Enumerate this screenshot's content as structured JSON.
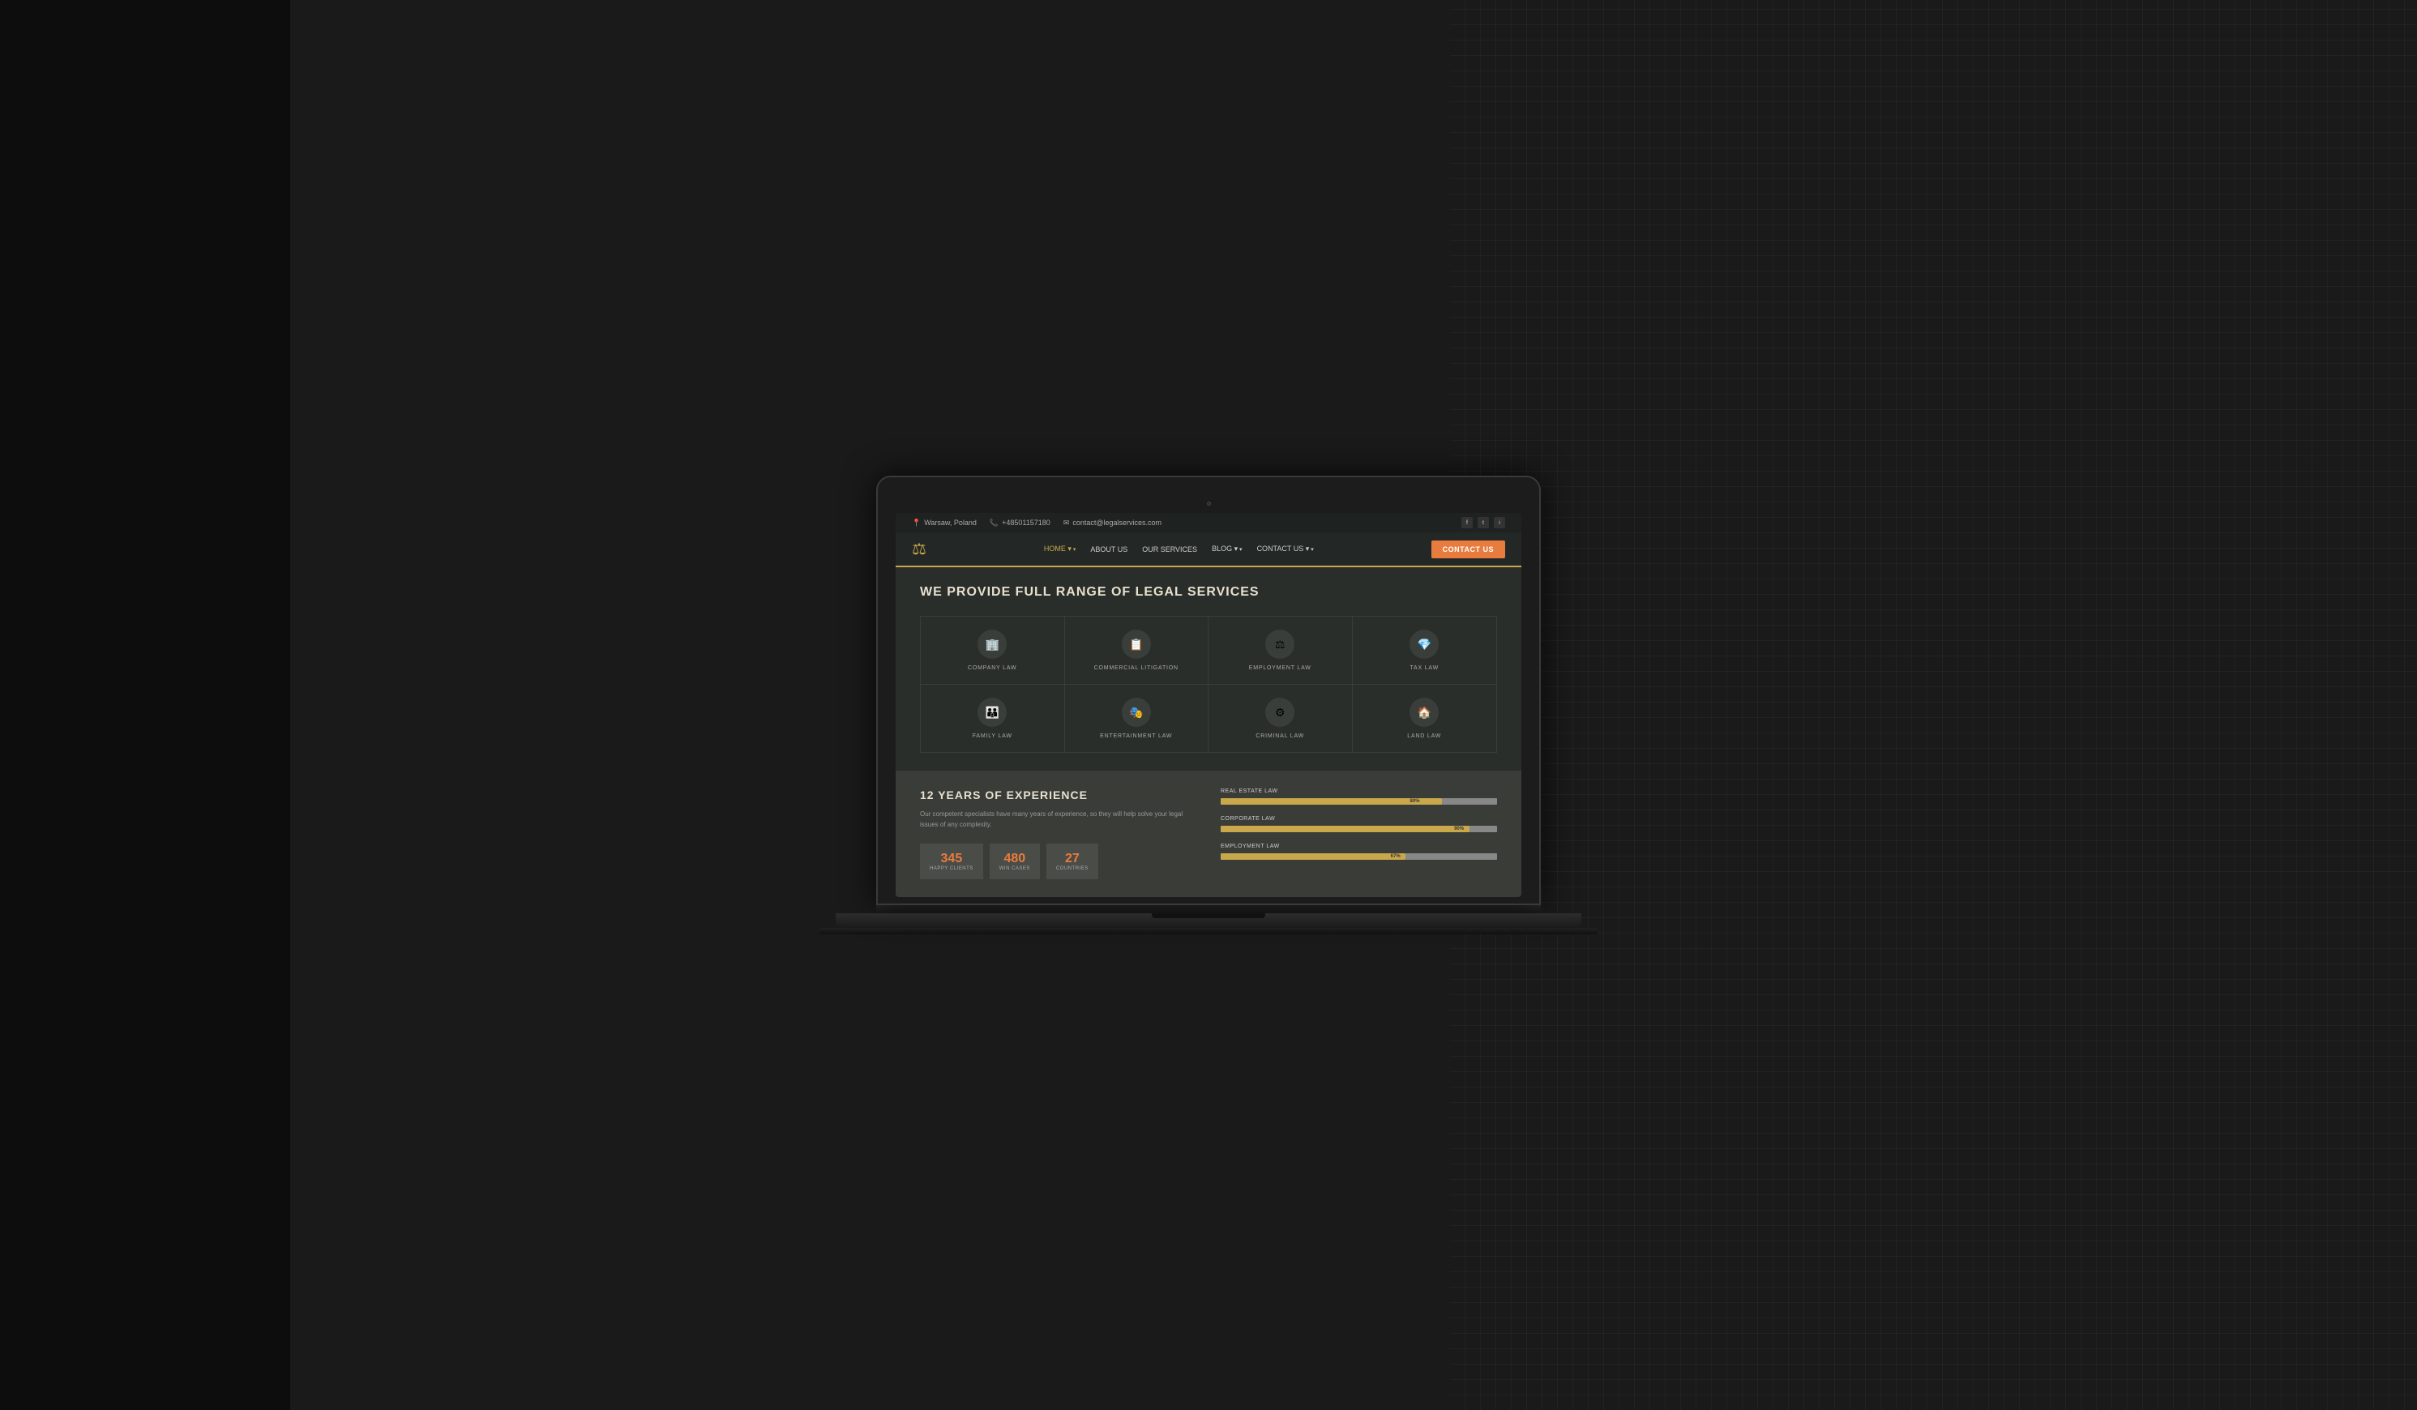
{
  "background": {
    "color": "#1a1a1a"
  },
  "topbar": {
    "location": "Warsaw, Poland",
    "phone": "+48501157180",
    "email": "contact@legalservices.com",
    "social": [
      "f",
      "t",
      "i"
    ]
  },
  "nav": {
    "logo_symbol": "⚖",
    "links": [
      {
        "label": "HOME",
        "active": true,
        "has_arrow": true
      },
      {
        "label": "ABOUT US",
        "active": false,
        "has_arrow": false
      },
      {
        "label": "OUR SERVICES",
        "active": false,
        "has_arrow": false
      },
      {
        "label": "BLOG",
        "active": false,
        "has_arrow": true
      },
      {
        "label": "CONTACT US",
        "active": false,
        "has_arrow": true
      }
    ],
    "cta_label": "CONTACT US"
  },
  "hero": {
    "title": "WE PROVIDE FULL RANGE OF LEGAL SERVICES"
  },
  "services": [
    {
      "icon": "🏢",
      "label": "COMPANY LAW"
    },
    {
      "icon": "📋",
      "label": "COMMERCIAL LITIGATION"
    },
    {
      "icon": "⚖",
      "label": "EMPLOYMENT LAW"
    },
    {
      "icon": "💎",
      "label": "TAX LAW"
    },
    {
      "icon": "👪",
      "label": "FAMILY LAW"
    },
    {
      "icon": "🎭",
      "label": "ENTERTAINMENT LAW"
    },
    {
      "icon": "⚙",
      "label": "CRIMINAL LAW"
    },
    {
      "icon": "🏠",
      "label": "LAND LAW"
    }
  ],
  "experience": {
    "title": "12 YEARS OF EXPERIENCE",
    "description": "Our competent specialists have many years of experience, so they will help solve your legal issues of any complexity.",
    "stats": [
      {
        "number": "345",
        "label": "HAPPY CLIENTS"
      },
      {
        "number": "480",
        "label": "WIN CASES"
      },
      {
        "number": "27",
        "label": "COUNTRIES"
      }
    ],
    "progress_bars": [
      {
        "label": "REAL ESTATE LAW",
        "value": 80,
        "display": "80%"
      },
      {
        "label": "CORPORATE LAW",
        "value": 90,
        "display": "90%"
      },
      {
        "label": "EMPLOYMENT LAW",
        "value": 67,
        "display": "67%"
      }
    ]
  }
}
